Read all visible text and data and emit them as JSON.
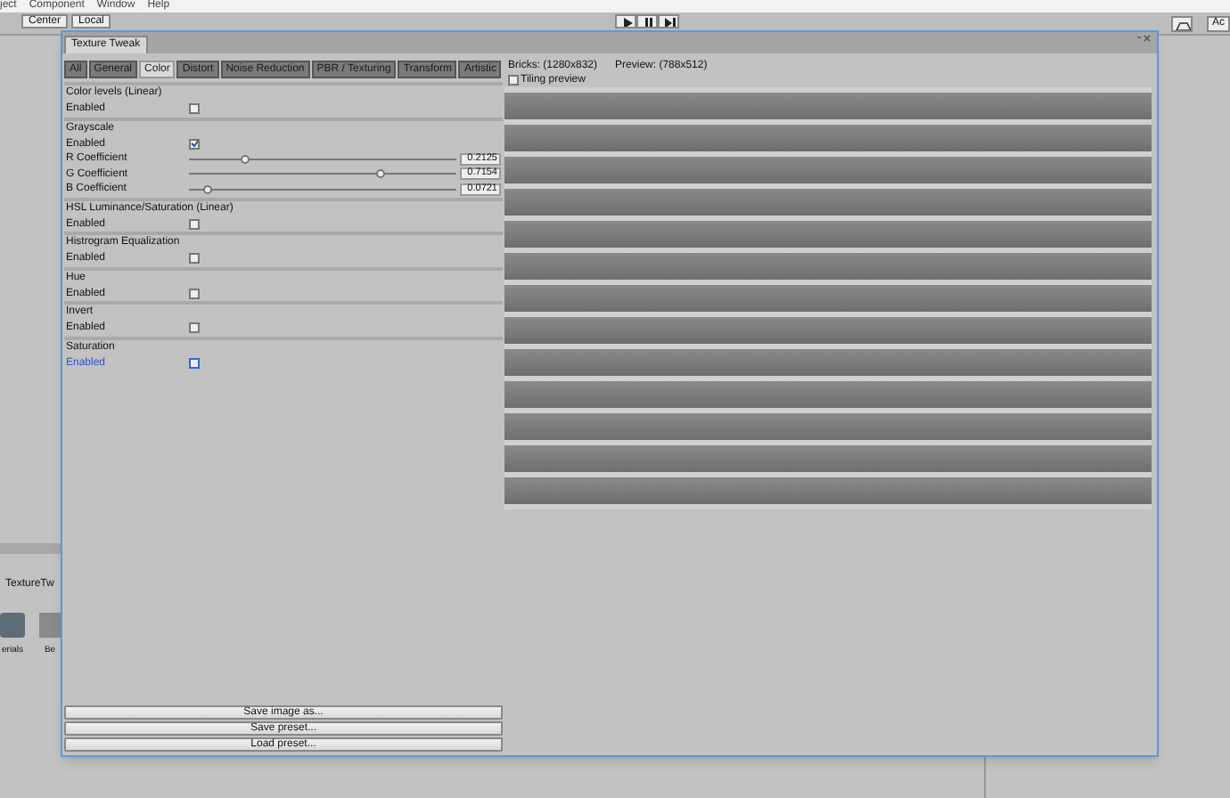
{
  "menu_bar": [
    "ject",
    "Component",
    "Window",
    "Help"
  ],
  "toolbar": {
    "pivot_buttons": [
      "Center",
      "Local"
    ],
    "right_button": "Ac"
  },
  "project_panel": {
    "breadcrumb": "TextureTw",
    "assets": [
      {
        "label": "erials",
        "kind": "folder"
      },
      {
        "label": "Be",
        "kind": "image"
      }
    ]
  },
  "window": {
    "title": "Texture Tweak",
    "tabs": [
      {
        "label": "All",
        "selected": false
      },
      {
        "label": "General",
        "selected": false
      },
      {
        "label": "Color",
        "selected": true
      },
      {
        "label": "Distort",
        "selected": false
      },
      {
        "label": "Noise Reduction",
        "selected": false
      },
      {
        "label": "PBR / Texturing",
        "selected": false
      },
      {
        "label": "Transform",
        "selected": false
      },
      {
        "label": "Artistic",
        "selected": false
      }
    ],
    "sections": [
      {
        "title": "Color levels (Linear)",
        "fields": [
          {
            "kind": "checkbox",
            "label": "Enabled",
            "checked": false,
            "focused": false
          }
        ]
      },
      {
        "title": "Grayscale",
        "fields": [
          {
            "kind": "checkbox",
            "label": "Enabled",
            "checked": true,
            "focused": false
          },
          {
            "kind": "slider",
            "label": "R Coefficient",
            "level": 0.2125,
            "value": "0.2125"
          },
          {
            "kind": "slider",
            "label": "G Coefficient",
            "level": 0.7154,
            "value": "0.7154"
          },
          {
            "kind": "slider",
            "label": "B Coefficient",
            "level": 0.0721,
            "value": "0.0721"
          }
        ]
      },
      {
        "title": "HSL Luminance/Saturation (Linear)",
        "fields": [
          {
            "kind": "checkbox",
            "label": "Enabled",
            "checked": false,
            "focused": false
          }
        ]
      },
      {
        "title": "Histrogram Equalization",
        "fields": [
          {
            "kind": "checkbox",
            "label": "Enabled",
            "checked": false,
            "focused": false
          }
        ]
      },
      {
        "title": "Hue",
        "fields": [
          {
            "kind": "checkbox",
            "label": "Enabled",
            "checked": false,
            "focused": false
          }
        ]
      },
      {
        "title": "Invert",
        "fields": [
          {
            "kind": "checkbox",
            "label": "Enabled",
            "checked": false,
            "focused": false
          }
        ]
      },
      {
        "title": "Saturation",
        "fields": [
          {
            "kind": "checkbox",
            "label": "Enabled",
            "checked": false,
            "focused": true
          }
        ]
      }
    ],
    "preview": {
      "source_info": "Bricks: (1280x832)",
      "preview_info": "Preview: (788x512)",
      "tiling_preview": {
        "label": "Tiling preview",
        "checked": false
      }
    },
    "buttons": [
      "Save image as...",
      "Save preset...",
      "Load preset..."
    ]
  }
}
